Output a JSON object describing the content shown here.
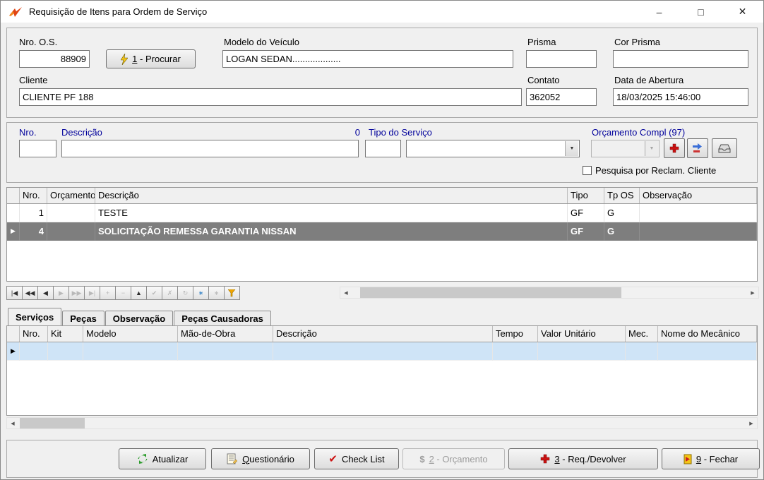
{
  "window": {
    "title": "Requisição de Itens para Ordem de Serviço",
    "minimize": "–",
    "maximize": "□",
    "close": "✕"
  },
  "icons": {
    "dropdown": "▼",
    "row_marker": "▶",
    "scroll_left": "◀",
    "scroll_right": "▶",
    "checkmark": "✔",
    "dollar": "$"
  },
  "header": {
    "nro_os_label": "Nro. O.S.",
    "nro_os_value": "88909",
    "procurar_mnemonic": "1",
    "procurar_rest": " - Procurar",
    "modelo_label": "Modelo do Veículo",
    "modelo_value": "LOGAN SEDAN...................",
    "prisma_label": "Prisma",
    "prisma_value": "",
    "cor_prisma_label": "Cor Prisma",
    "cor_prisma_value": "",
    "cliente_label": "Cliente",
    "cliente_value": "CLIENTE PF 188",
    "contato_label": "Contato",
    "contato_value": "362052",
    "data_abertura_label": "Data de Abertura",
    "data_abertura_value": "18/03/2025 15:46:00"
  },
  "filter": {
    "nro_label": "Nro.",
    "nro_value": "",
    "descricao_label": "Descrição",
    "descricao_value": "",
    "count": "0",
    "tipo_servico_label": "Tipo do Serviço",
    "tipo_servico_code_value": "",
    "tipo_servico_value": "",
    "orcamento_compl_label": "Orçamento Compl (97)",
    "orcamento_compl_value": "",
    "checkbox_label": "Pesquisa por Reclam. Cliente"
  },
  "items_grid": {
    "columns": [
      "Nro.",
      "Orçamento",
      "Descrição",
      "Tipo",
      "Tp OS",
      "Observação"
    ],
    "rows": [
      [
        "1",
        "",
        "TESTE",
        "GF",
        "G",
        ""
      ],
      [
        "4",
        "",
        "SOLICITAÇÃO REMESSA GARANTIA NISSAN",
        "GF",
        "G",
        ""
      ]
    ]
  },
  "navigator": {
    "buttons": [
      "|◀",
      "◀◀",
      "◀",
      "▶",
      "▶▶",
      "▶|",
      "+",
      "−",
      "▲",
      "✔",
      "✗",
      "↻",
      "∗",
      "∗"
    ]
  },
  "tabs": [
    "Serviços",
    "Peças",
    "Observação",
    "Peças Causadoras"
  ],
  "services_grid": {
    "columns": [
      "Nro.",
      "Kit",
      "Modelo",
      "Mão-de-Obra",
      "Descrição",
      "Tempo",
      "Valor Unitário",
      "Mec.",
      "Nome do Mecânico"
    ]
  },
  "footer": {
    "atualizar_label": "Atualizar",
    "questionario_mnemonic": "Q",
    "questionario_rest": "uestionário",
    "checklist_label": "Check List",
    "orcamento_mnemonic": "2",
    "orcamento_rest": " - Orçamento",
    "req_mnemonic": "3",
    "req_rest": " - Req./Devolver",
    "fechar_mnemonic": "9",
    "fechar_rest": " - Fechar"
  }
}
